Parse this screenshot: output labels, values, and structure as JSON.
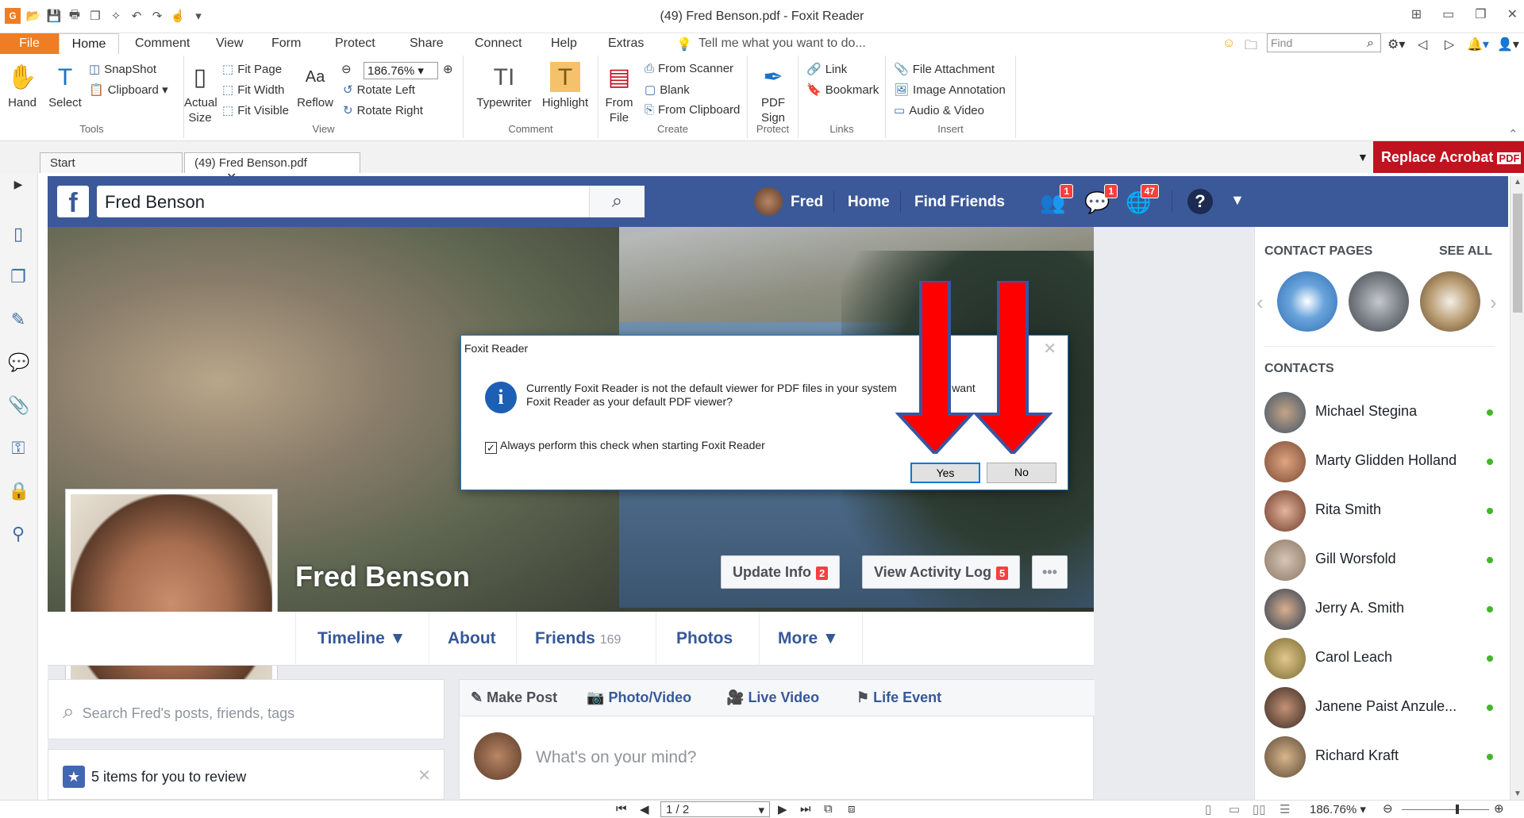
{
  "window": {
    "title": "(49) Fred Benson.pdf - Foxit Reader"
  },
  "menu": {
    "file": "File",
    "tabs": [
      "Home",
      "Comment",
      "View",
      "Form",
      "Protect",
      "Share",
      "Connect",
      "Help",
      "Extras"
    ],
    "tell_me": "Tell me what you want to do...",
    "find_placeholder": "Find"
  },
  "ribbon": {
    "tools": {
      "hand": "Hand",
      "select": "Select",
      "snapshot": "SnapShot",
      "clipboard": "Clipboard",
      "label": "Tools"
    },
    "view": {
      "actual_size": "Actual Size",
      "fit_page": "Fit Page",
      "fit_width": "Fit Width",
      "fit_visible": "Fit Visible",
      "reflow": "Reflow",
      "zoom": "186.76%",
      "rotate_left": "Rotate Left",
      "rotate_right": "Rotate Right",
      "label": "View"
    },
    "comment": {
      "typewriter": "Typewriter",
      "highlight": "Highlight",
      "label": "Comment"
    },
    "create": {
      "from_file": "From File",
      "from_scanner": "From Scanner",
      "blank": "Blank",
      "from_clipboard": "From Clipboard",
      "label": "Create"
    },
    "protect": {
      "pdf_sign": "PDF Sign",
      "label": "Protect"
    },
    "links": {
      "link": "Link",
      "bookmark": "Bookmark",
      "label": "Links"
    },
    "insert": {
      "file_attachment": "File Attachment",
      "image_annotation": "Image Annotation",
      "audio_video": "Audio & Video",
      "label": "Insert"
    }
  },
  "doc_tabs": {
    "start": "Start",
    "current": "(49) Fred Benson.pdf",
    "replace_acrobat": "Replace Acrobat"
  },
  "facebook": {
    "search_value": "Fred Benson",
    "nav": {
      "user": "Fred",
      "home": "Home",
      "find_friends": "Find Friends"
    },
    "badges": {
      "friends": "1",
      "messages": "1",
      "notifications": "47"
    },
    "profile_name": "Fred Benson",
    "update_info": "Update Info",
    "update_info_count": "2",
    "activity_log": "View Activity Log",
    "activity_log_count": "5",
    "more_dots": "•••",
    "tabs": {
      "timeline": "Timeline ▼",
      "about": "About",
      "friends": "Friends",
      "friends_count": "169",
      "photos": "Photos",
      "more": "More ▼"
    },
    "search_posts_placeholder": "Search Fred's posts, friends, tags",
    "review": "5 items for you to review",
    "composer": {
      "make_post": "Make Post",
      "photo_video": "Photo/Video",
      "live_video": "Live Video",
      "life_event": "Life Event",
      "placeholder": "What's on your mind?"
    },
    "contact_pages": "CONTACT PAGES",
    "see_all": "SEE ALL",
    "contacts_header": "CONTACTS",
    "contacts": [
      "Michael Stegina",
      "Marty Glidden Holland",
      "Rita Smith",
      "Gill Worsfold",
      "Jerry A. Smith",
      "Carol Leach",
      "Janene Paist Anzule...",
      "Richard Kraft"
    ]
  },
  "dialog": {
    "title": "Foxit Reader",
    "message": "Currently Foxit Reader is not the default viewer for PDF files in your system",
    "message_tail": "ou want",
    "message_line2": "Foxit Reader as your default PDF viewer?",
    "checkbox": "Always perform this check when starting Foxit Reader",
    "yes": "Yes",
    "no": "No",
    "arrow_color": "#ff0000"
  },
  "status": {
    "page": "1 / 2",
    "zoom": "186.76%"
  }
}
